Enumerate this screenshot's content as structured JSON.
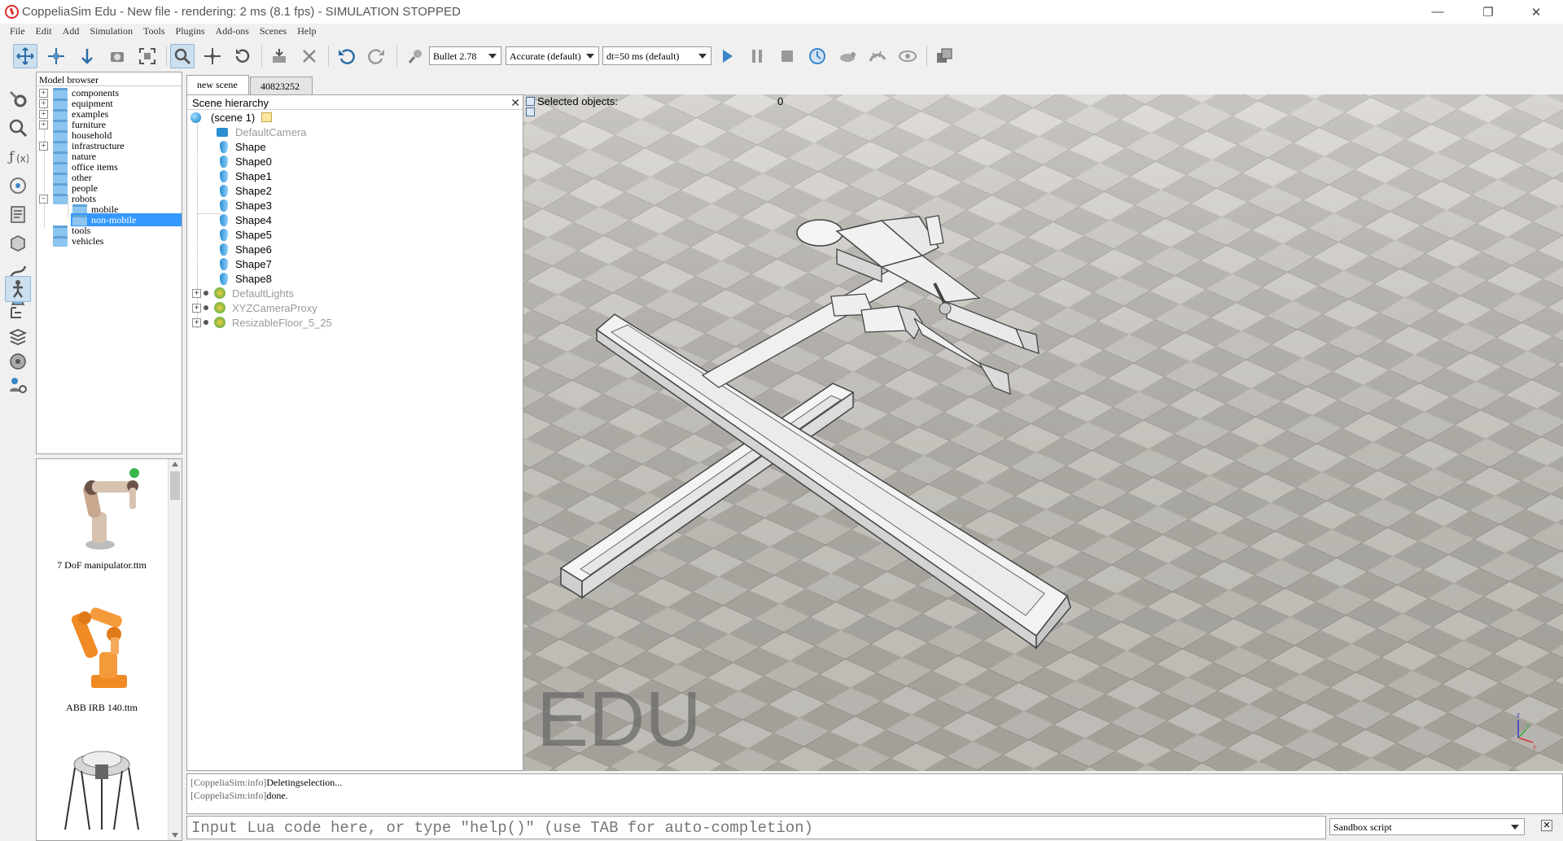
{
  "window": {
    "title": "CoppeliaSim Edu - New file - rendering: 2 ms (8.1 fps) - SIMULATION STOPPED",
    "minimize": "—",
    "maximize": "❐",
    "close": "✕"
  },
  "menu": [
    "File",
    "Edit",
    "Add",
    "Simulation",
    "Tools",
    "Plugins",
    "Add-ons",
    "Scenes",
    "Help"
  ],
  "toolbar": {
    "engine": "Bullet 2.78",
    "accuracy": "Accurate (default)",
    "timestep": "dt=50 ms (default)"
  },
  "model_browser": {
    "title": "Model browser",
    "folders": [
      "components",
      "equipment",
      "examples",
      "furniture",
      "household",
      "infrastructure",
      "nature",
      "office items",
      "other",
      "people",
      "robots",
      "mobile",
      "non-mobile",
      "tools",
      "vehicles"
    ],
    "selected": "non-mobile"
  },
  "model_previews": [
    "7 DoF manipulator.ttm",
    "ABB IRB 140.ttm"
  ],
  "scene_tabs": [
    "new scene",
    "40823252"
  ],
  "hierarchy": {
    "title": "Scene hierarchy",
    "root": "(scene 1)",
    "items": [
      "DefaultCamera",
      "Shape",
      "Shape0",
      "Shape1",
      "Shape2",
      "Shape3",
      "Shape4",
      "Shape5",
      "Shape6",
      "Shape7",
      "Shape8",
      "DefaultLights",
      "XYZCameraProxy",
      "ResizableFloor_5_25"
    ]
  },
  "viewport": {
    "selected_label": "Selected objects:",
    "selected_count": "0",
    "watermark": "EDU",
    "axis_labels": [
      "x",
      "y",
      "z"
    ]
  },
  "console": {
    "lines": [
      {
        "prefix": "[CoppeliaSim:info]",
        "text": "Deletingselection..."
      },
      {
        "prefix": "[CoppeliaSim:info]",
        "text": "done."
      }
    ]
  },
  "command": {
    "placeholder": "Input Lua code here, or type \"help()\" (use TAB for auto-completion)",
    "script": "Sandbox script"
  }
}
